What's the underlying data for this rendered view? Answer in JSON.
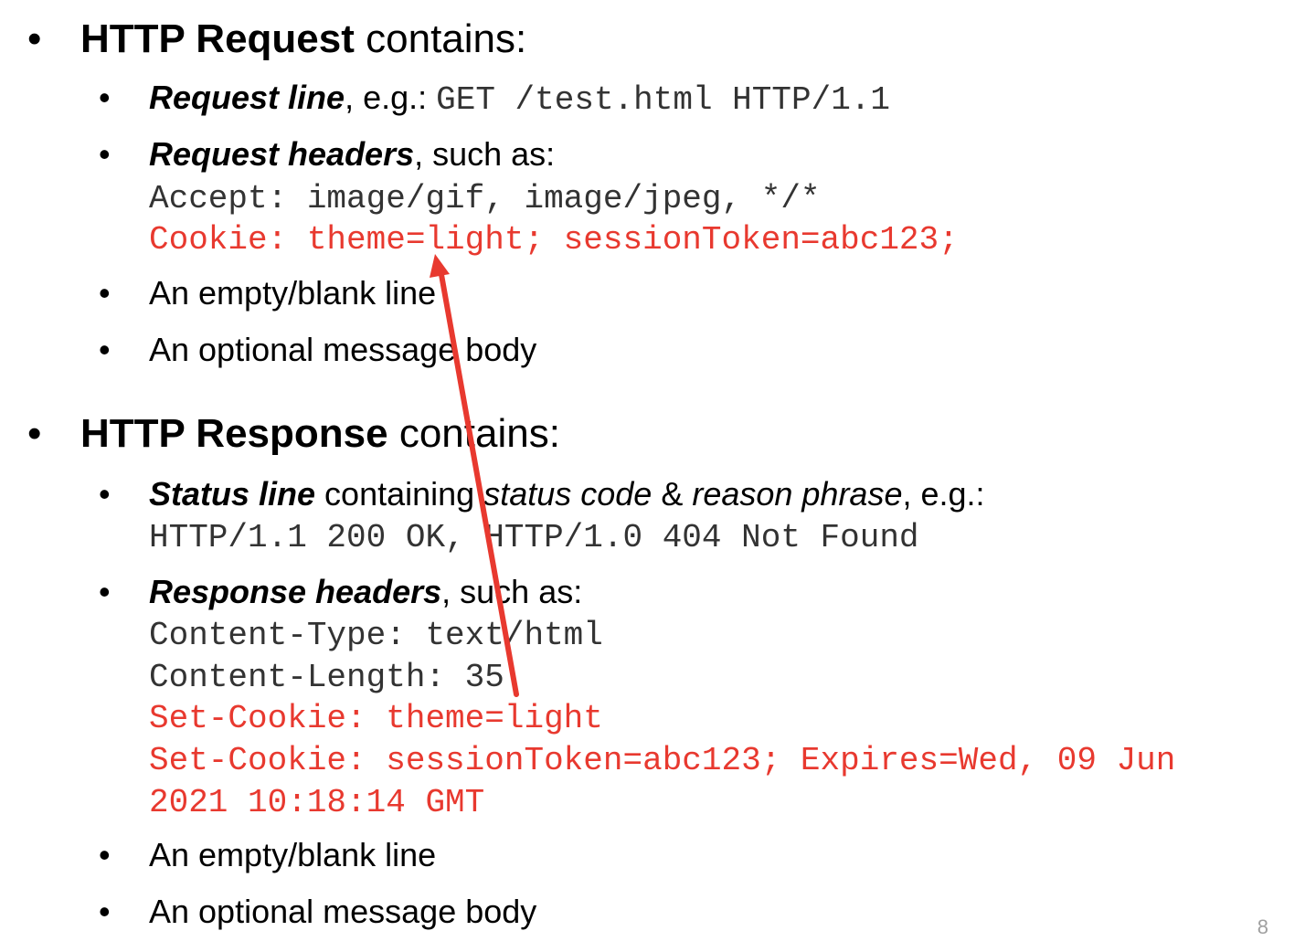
{
  "request": {
    "title_bold": "HTTP Request",
    "title_rest": " contains:",
    "items": {
      "request_line": {
        "label": "Request line",
        "sep": ", e.g.: ",
        "code": "GET /test.html HTTP/1.1"
      },
      "request_headers": {
        "label": "Request headers",
        "suffix": ", such as:"
      },
      "header_accept": "Accept: image/gif, image/jpeg, */*",
      "header_cookie": "Cookie: theme=light; sessionToken=abc123;",
      "blank_line": "An empty/blank line",
      "body": "An optional message body"
    }
  },
  "response": {
    "title_bold": "HTTP Response",
    "title_rest": " contains:",
    "items": {
      "status_line": {
        "label": "Status line",
        "text1": " containing ",
        "status_code": "status code",
        "text2": " & ",
        "reason_phrase": "reason phrase",
        "text3": ", e.g.:",
        "code": "HTTP/1.1 200 OK, HTTP/1.0 404 Not Found"
      },
      "response_headers": {
        "label": "Response headers",
        "suffix": ", such as:"
      },
      "header_content_type": "Content-Type: text/html",
      "header_content_length": "Content-Length: 35",
      "set_cookie_1": "Set-Cookie: theme=light",
      "set_cookie_2a": "Set-Cookie: sessionToken=abc123; Expires=Wed, 09 Jun",
      "set_cookie_2b": "2021 10:18:14 GMT",
      "blank_line": "An empty/blank line",
      "body": "An optional message body"
    }
  },
  "colors": {
    "highlight": "#e8392f",
    "code": "#333333"
  },
  "page_number": "8"
}
